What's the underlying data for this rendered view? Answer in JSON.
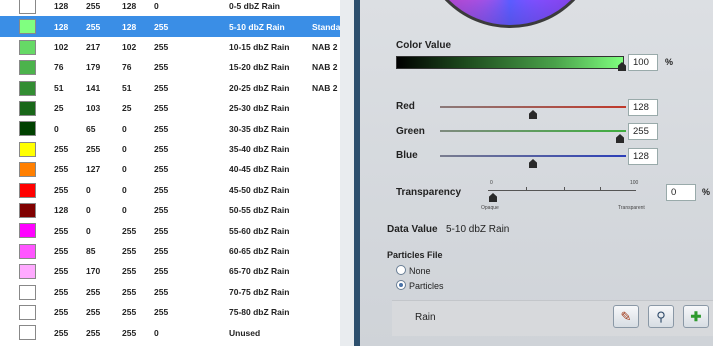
{
  "table": {
    "rows": [
      {
        "r": "128",
        "g": "255",
        "b": "128",
        "a": "0",
        "label": "0-5 dbZ Rain",
        "extra": "",
        "color": "#ffffff",
        "selected": false
      },
      {
        "r": "128",
        "g": "255",
        "b": "128",
        "a": "255",
        "label": "5-10 dbZ Rain",
        "extra": "Standa",
        "color": "#80ff80",
        "selected": true
      },
      {
        "r": "102",
        "g": "217",
        "b": "102",
        "a": "255",
        "label": "10-15 dbZ Rain",
        "extra": "NAB 2",
        "color": "#66d966",
        "selected": false
      },
      {
        "r": "76",
        "g": "179",
        "b": "76",
        "a": "255",
        "label": "15-20 dbZ Rain",
        "extra": "NAB 2",
        "color": "#4cb34c",
        "selected": false
      },
      {
        "r": "51",
        "g": "141",
        "b": "51",
        "a": "255",
        "label": "20-25 dbZ Rain",
        "extra": "NAB 2",
        "color": "#338d33",
        "selected": false
      },
      {
        "r": "25",
        "g": "103",
        "b": "25",
        "a": "255",
        "label": "25-30 dbZ Rain",
        "extra": "",
        "color": "#196719",
        "selected": false
      },
      {
        "r": "0",
        "g": "65",
        "b": "0",
        "a": "255",
        "label": "30-35 dbZ Rain",
        "extra": "",
        "color": "#004100",
        "selected": false
      },
      {
        "r": "255",
        "g": "255",
        "b": "0",
        "a": "255",
        "label": "35-40 dbZ Rain",
        "extra": "",
        "color": "#ffff00",
        "selected": false
      },
      {
        "r": "255",
        "g": "127",
        "b": "0",
        "a": "255",
        "label": "40-45 dbZ Rain",
        "extra": "",
        "color": "#ff7f00",
        "selected": false
      },
      {
        "r": "255",
        "g": "0",
        "b": "0",
        "a": "255",
        "label": "45-50 dbZ Rain",
        "extra": "",
        "color": "#ff0000",
        "selected": false
      },
      {
        "r": "128",
        "g": "0",
        "b": "0",
        "a": "255",
        "label": "50-55 dbZ Rain",
        "extra": "",
        "color": "#800000",
        "selected": false
      },
      {
        "r": "255",
        "g": "0",
        "b": "255",
        "a": "255",
        "label": "55-60 dbZ Rain",
        "extra": "",
        "color": "#ff00ff",
        "selected": false
      },
      {
        "r": "255",
        "g": "85",
        "b": "255",
        "a": "255",
        "label": "60-65 dbZ Rain",
        "extra": "",
        "color": "#ff55ff",
        "selected": false
      },
      {
        "r": "255",
        "g": "170",
        "b": "255",
        "a": "255",
        "label": "65-70 dbZ Rain",
        "extra": "",
        "color": "#ffaaff",
        "selected": false
      },
      {
        "r": "255",
        "g": "255",
        "b": "255",
        "a": "255",
        "label": "70-75 dbZ Rain",
        "extra": "",
        "color": "#ffffff",
        "selected": false
      },
      {
        "r": "255",
        "g": "255",
        "b": "255",
        "a": "255",
        "label": "75-80 dbZ Rain",
        "extra": "",
        "color": "#ffffff",
        "selected": false
      },
      {
        "r": "255",
        "g": "255",
        "b": "255",
        "a": "0",
        "label": "Unused",
        "extra": "",
        "color": "#ffffff",
        "selected": false
      }
    ]
  },
  "panel": {
    "color_value_label": "Color Value",
    "color_value": "100",
    "percent_symbol": "%",
    "color_value_fraction": 1.0,
    "red_label": "Red",
    "red_value": "128",
    "green_label": "Green",
    "green_value": "255",
    "blue_label": "Blue",
    "blue_value": "128",
    "transparency_label": "Transparency",
    "transparency_value": "0",
    "transparency_min": "0",
    "transparency_max": "100",
    "opaque_label": "Opaque",
    "transparent_label": "Transparent",
    "data_value_label": "Data Value",
    "data_value": "5-10 dbZ Rain",
    "particles_file_label": "Particles File",
    "radio_none": "None",
    "radio_particles": "Particles",
    "selected_radio": "Particles",
    "particle_name": "Rain",
    "tool_icons": [
      "pencil-icon",
      "magnifier-icon",
      "plus-icon"
    ]
  },
  "colors": {
    "selection": "#3a8ee6",
    "divider": "#2d4f6d",
    "red_track": "#c0392b",
    "green_track": "#3fae3f",
    "blue_track": "#2c3fb8"
  }
}
